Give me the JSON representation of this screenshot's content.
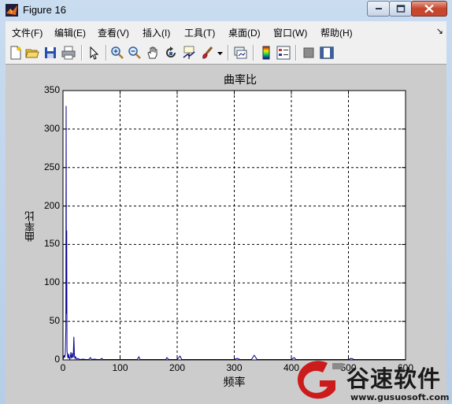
{
  "window": {
    "title": "Figure 16",
    "buttons": [
      "minimize",
      "maximize",
      "close"
    ]
  },
  "menubar": {
    "items": [
      "文件(F)",
      "编辑(E)",
      "查看(V)",
      "插入(I)",
      "工具(T)",
      "桌面(D)",
      "窗口(W)",
      "帮助(H)"
    ]
  },
  "toolbar": {
    "icons": [
      "new-figure-icon",
      "open-file-icon",
      "save-icon",
      "print-icon",
      "edit-plot-arrow-icon",
      "zoom-in-icon",
      "zoom-out-icon",
      "pan-hand-icon",
      "rotate-3d-icon",
      "data-cursor-icon",
      "brush-icon",
      "brush-dropdown-icon",
      "link-plot-icon",
      "colorbar-icon",
      "legend-icon",
      "hide-plot-tools-icon",
      "show-plot-tools-icon"
    ]
  },
  "chart_data": {
    "type": "line",
    "title": "曲率比",
    "xlabel": "频率",
    "ylabel": "曲率比",
    "xlim": [
      0,
      600
    ],
    "ylim": [
      0,
      350
    ],
    "xticks": [
      "0",
      "100",
      "200",
      "300",
      "400",
      "500",
      "600"
    ],
    "yticks": [
      "0",
      "50",
      "100",
      "150",
      "200",
      "250",
      "300",
      "350"
    ],
    "grid": true,
    "series": [
      {
        "color": "#00008b",
        "x": [
          0,
          2,
          3,
          4,
          5,
          5.5,
          6,
          6.5,
          7,
          8,
          9,
          10,
          11,
          12,
          13,
          14,
          15,
          16,
          17,
          18,
          19,
          20,
          21,
          22,
          24,
          26,
          28,
          30,
          35,
          40,
          45,
          48,
          50,
          55,
          60,
          65,
          68,
          70,
          75,
          80,
          90,
          100,
          110,
          120,
          130,
          133,
          135,
          140,
          150,
          160,
          170,
          180,
          182,
          185,
          190,
          200,
          205,
          208,
          210,
          220,
          230,
          240,
          250,
          260,
          270,
          280,
          290,
          300,
          305,
          310,
          320,
          330,
          335,
          340,
          350,
          360,
          370,
          380,
          390,
          400,
          405,
          408,
          410,
          420,
          430,
          440,
          450,
          460,
          470,
          480,
          490,
          500,
          505,
          510,
          520,
          530,
          540,
          550,
          560,
          570,
          580,
          590,
          600
        ],
        "y": [
          0,
          6,
          3,
          8,
          40,
          330,
          60,
          168,
          12,
          5,
          2,
          8,
          3,
          1,
          5,
          10,
          2,
          4,
          9,
          3,
          30,
          6,
          2,
          4,
          1,
          2,
          1,
          0.5,
          1,
          0.5,
          0.5,
          3,
          0.5,
          1,
          0.5,
          0.5,
          2,
          0.5,
          0.5,
          0.5,
          0.5,
          0.5,
          0.5,
          0.5,
          0.5,
          4,
          0.5,
          0.5,
          0.5,
          0.5,
          0.5,
          0.5,
          3,
          0.5,
          0.5,
          0.5,
          5,
          0.5,
          0.5,
          0.5,
          0.5,
          0.5,
          0.5,
          0.5,
          0.5,
          0.5,
          0.5,
          0.5,
          2,
          0.5,
          0.5,
          0.5,
          6,
          0.5,
          0.5,
          0.5,
          0.5,
          0.5,
          0.5,
          0.5,
          3,
          0.5,
          0.5,
          0.5,
          0.5,
          0.5,
          0.5,
          0.5,
          0.5,
          0.5,
          0.5,
          0.5,
          2,
          0.5,
          0.5,
          0.5,
          0.5,
          0.5,
          0.5,
          0.5,
          0.5,
          0.5,
          0.5
        ]
      }
    ]
  },
  "watermark": {
    "brand": "谷速软件",
    "url": "www.gusuosoft.com",
    "logo_colors": [
      "#cc1b1b",
      "#8a8a8a"
    ]
  }
}
